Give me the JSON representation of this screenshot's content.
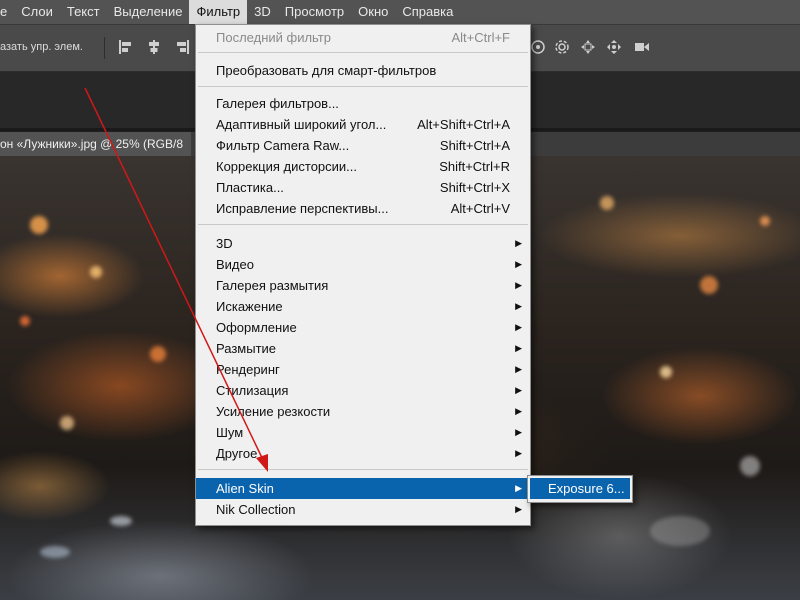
{
  "menubar": {
    "items": [
      {
        "label": "е"
      },
      {
        "label": "Слои"
      },
      {
        "label": "Текст"
      },
      {
        "label": "Выделение"
      },
      {
        "label": "Фильтр"
      },
      {
        "label": "3D"
      },
      {
        "label": "Просмотр"
      },
      {
        "label": "Окно"
      },
      {
        "label": "Справка"
      }
    ],
    "active_label": "Фильтр"
  },
  "options_bar": {
    "autoselect_text": "азать упр. элем."
  },
  "document_tab": {
    "title": "он «Лужники».jpg @ 25% (RGB/8"
  },
  "filter_menu": {
    "last_filter": {
      "label": "Последний фильтр",
      "shortcut": "Alt+Ctrl+F"
    },
    "smart": {
      "label": "Преобразовать для смарт-фильтров"
    },
    "group_a": [
      {
        "label": "Галерея фильтров...",
        "shortcut": ""
      },
      {
        "label": "Адаптивный широкий угол...",
        "shortcut": "Alt+Shift+Ctrl+A"
      },
      {
        "label": "Фильтр Camera Raw...",
        "shortcut": "Shift+Ctrl+A"
      },
      {
        "label": "Коррекция дисторсии...",
        "shortcut": "Shift+Ctrl+R"
      },
      {
        "label": "Пластика...",
        "shortcut": "Shift+Ctrl+X"
      },
      {
        "label": "Исправление перспективы...",
        "shortcut": "Alt+Ctrl+V"
      }
    ],
    "group_b": [
      {
        "label": "3D"
      },
      {
        "label": "Видео"
      },
      {
        "label": "Галерея размытия"
      },
      {
        "label": "Искажение"
      },
      {
        "label": "Оформление"
      },
      {
        "label": "Размытие"
      },
      {
        "label": "Рендеринг"
      },
      {
        "label": "Стилизация"
      },
      {
        "label": "Усиление резкости"
      },
      {
        "label": "Шум"
      },
      {
        "label": "Другое"
      }
    ],
    "plugins": [
      {
        "label": "Alien Skin"
      },
      {
        "label": "Nik Collection"
      }
    ],
    "highlighted": "Alien Skin"
  },
  "submenu": {
    "items": [
      {
        "label": "Exposure 6..."
      }
    ]
  },
  "colors": {
    "menubar_bg": "#535353",
    "menu_bg": "#f0f0f0",
    "highlight": "#0a64ad",
    "annotation_arrow": "#d01818"
  },
  "icons": [
    "align-left-icon",
    "align-hcenter-icon",
    "align-right-icon",
    "rotate-3d-icon",
    "roll-3d-icon",
    "pan-3d-icon",
    "slide-3d-icon",
    "video-camera-icon",
    "submenu-arrow-icon"
  ]
}
